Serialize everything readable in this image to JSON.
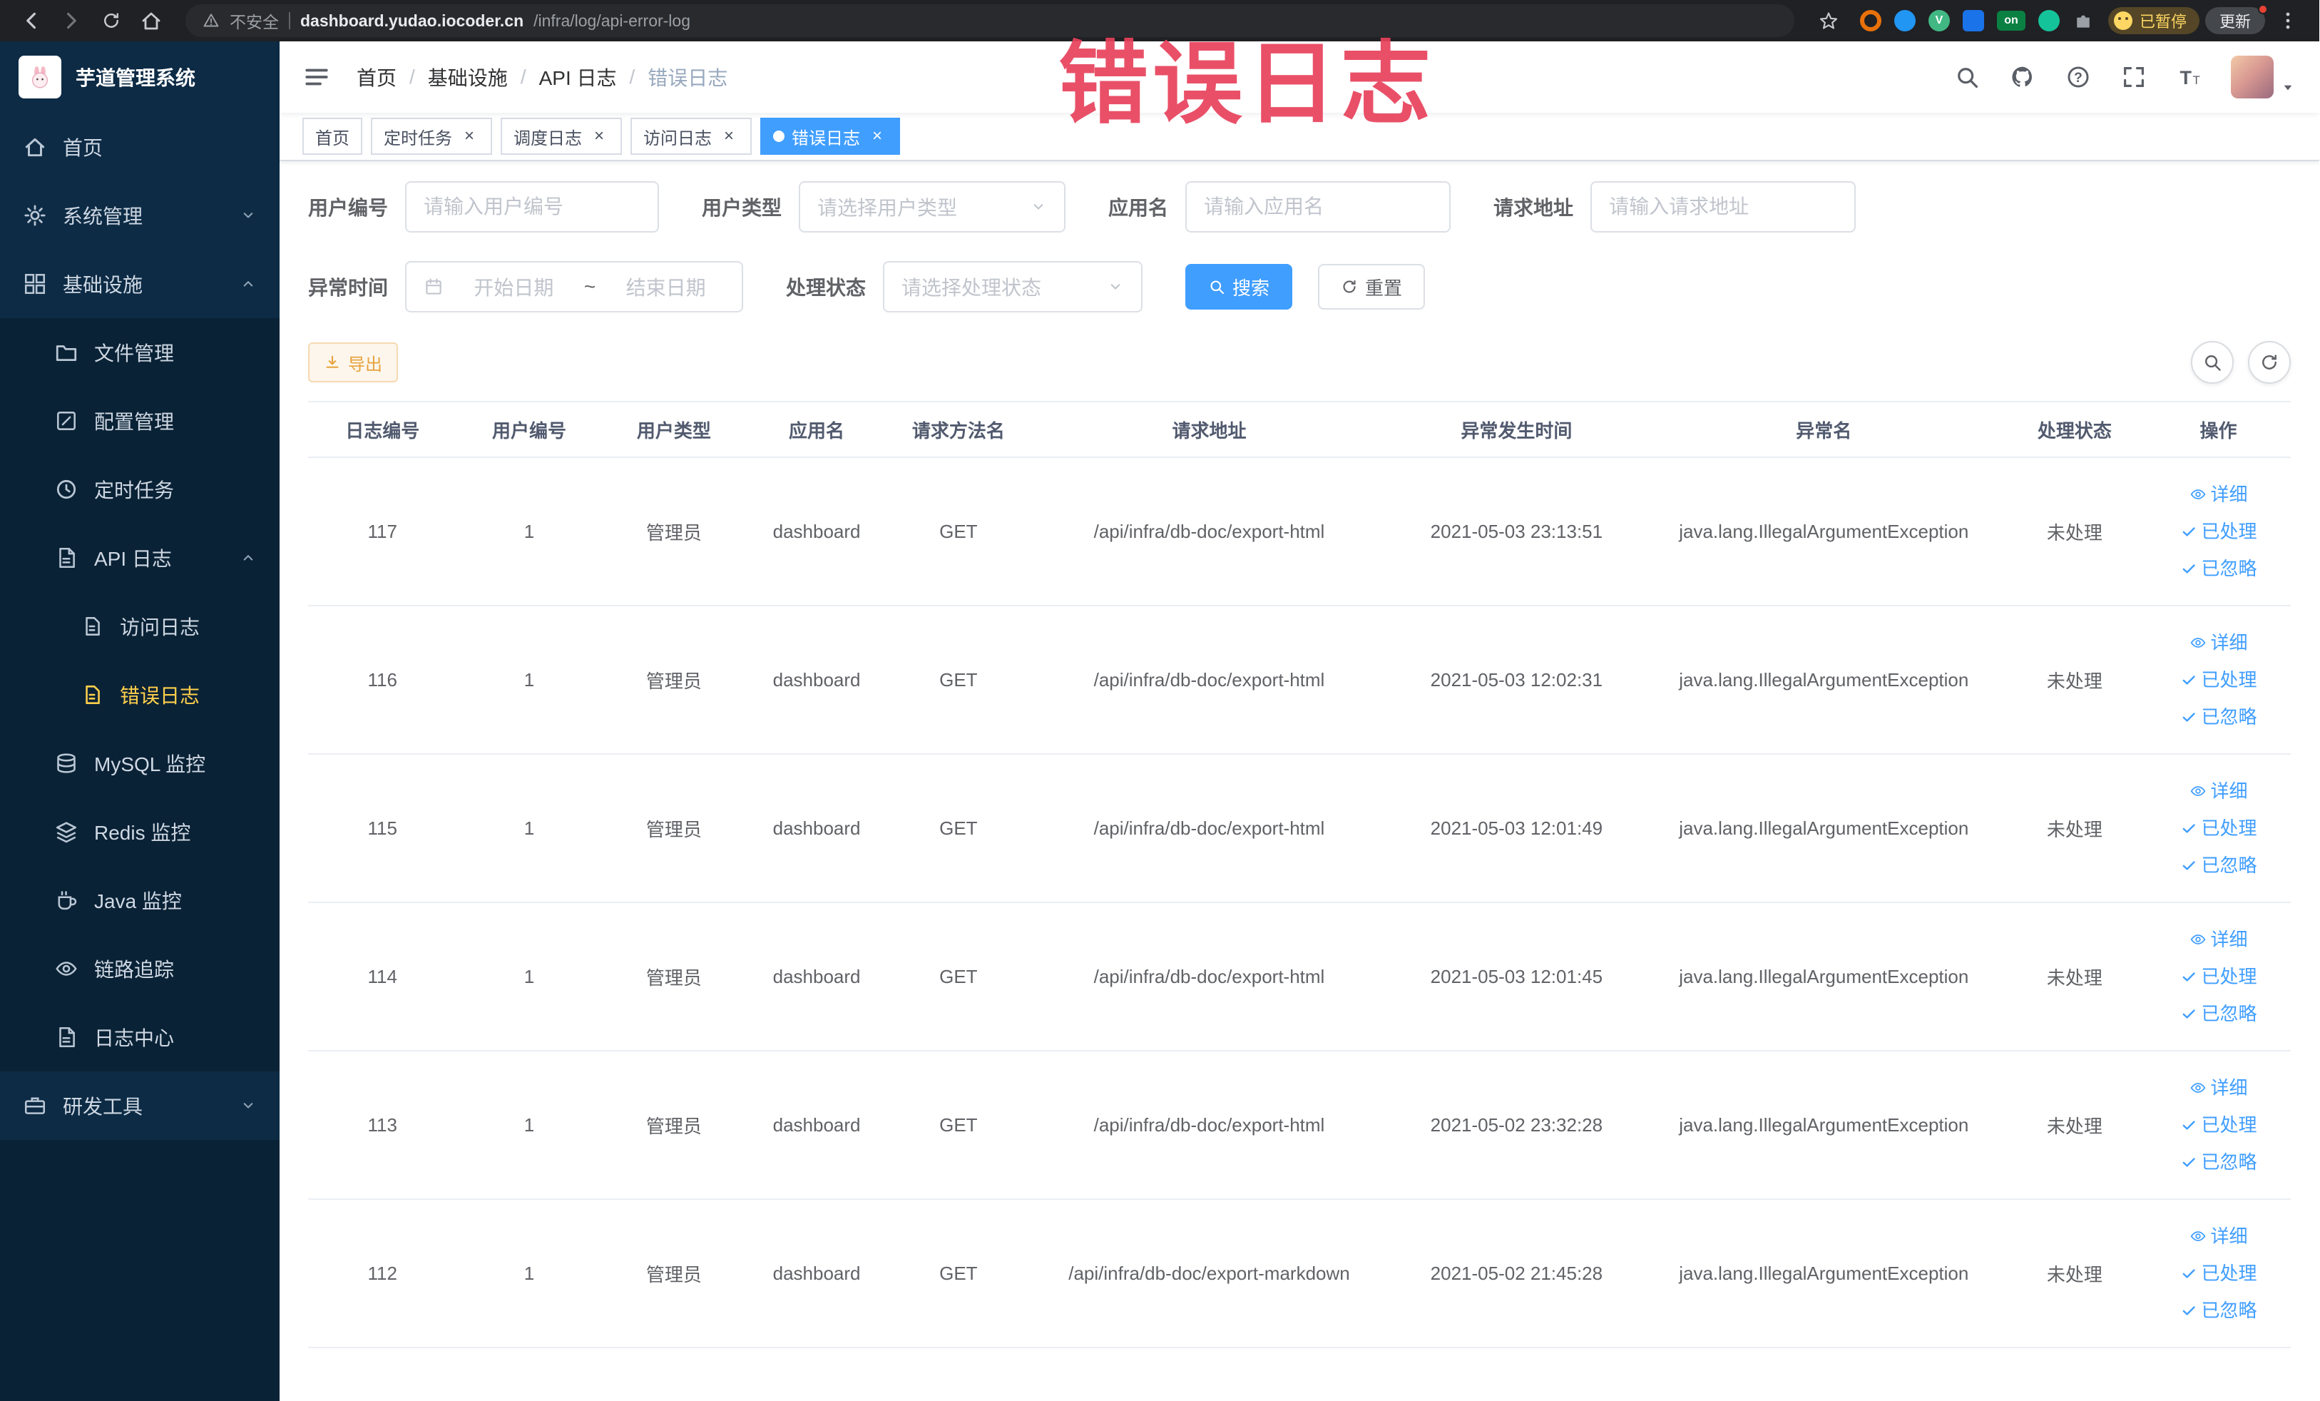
{
  "browser": {
    "security_label": "不安全",
    "url_host": "dashboard.yudao.iocoder.cn",
    "url_path": "/infra/log/api-error-log",
    "paused_label": "已暂停",
    "update_label": "更新",
    "ext_on_label": "on",
    "ext_v_label": "V"
  },
  "sidebar": {
    "logo_title": "芋道管理系统",
    "items": [
      {
        "label": "首页"
      },
      {
        "label": "系统管理"
      },
      {
        "label": "基础设施"
      },
      {
        "label": "文件管理"
      },
      {
        "label": "配置管理"
      },
      {
        "label": "定时任务"
      },
      {
        "label": "API 日志"
      },
      {
        "label": "访问日志"
      },
      {
        "label": "错误日志"
      },
      {
        "label": "MySQL 监控"
      },
      {
        "label": "Redis 监控"
      },
      {
        "label": "Java 监控"
      },
      {
        "label": "链路追踪"
      },
      {
        "label": "日志中心"
      },
      {
        "label": "研发工具"
      }
    ]
  },
  "navbar": {
    "breadcrumb": [
      "首页",
      "基础设施",
      "API 日志",
      "错误日志"
    ]
  },
  "tabs": [
    {
      "label": "首页"
    },
    {
      "label": "定时任务"
    },
    {
      "label": "调度日志"
    },
    {
      "label": "访问日志"
    },
    {
      "label": "错误日志"
    }
  ],
  "watermark": "错误日志",
  "filters": {
    "user_id_label": "用户编号",
    "user_id_placeholder": "请输入用户编号",
    "user_type_label": "用户类型",
    "user_type_placeholder": "请选择用户类型",
    "app_name_label": "应用名",
    "app_name_placeholder": "请输入应用名",
    "request_url_label": "请求地址",
    "request_url_placeholder": "请输入请求地址",
    "exception_time_label": "异常时间",
    "start_placeholder": "开始日期",
    "range_separator": "~",
    "end_placeholder": "结束日期",
    "process_status_label": "处理状态",
    "process_status_placeholder": "请选择处理状态",
    "search_label": "搜索",
    "reset_label": "重置"
  },
  "toolbar": {
    "export_label": "导出"
  },
  "table": {
    "headers": [
      "日志编号",
      "用户编号",
      "用户类型",
      "应用名",
      "请求方法名",
      "请求地址",
      "异常发生时间",
      "异常名",
      "处理状态",
      "操作"
    ],
    "actions": [
      "详细",
      "已处理",
      "已忽略"
    ],
    "rows": [
      {
        "id": "117",
        "user_id": "1",
        "user_type": "管理员",
        "app": "dashboard",
        "method": "GET",
        "url": "/api/infra/db-doc/export-html",
        "time": "2021-05-03 23:13:51",
        "exception": "java.lang.IllegalArgumentException",
        "status": "未处理"
      },
      {
        "id": "116",
        "user_id": "1",
        "user_type": "管理员",
        "app": "dashboard",
        "method": "GET",
        "url": "/api/infra/db-doc/export-html",
        "time": "2021-05-03 12:02:31",
        "exception": "java.lang.IllegalArgumentException",
        "status": "未处理"
      },
      {
        "id": "115",
        "user_id": "1",
        "user_type": "管理员",
        "app": "dashboard",
        "method": "GET",
        "url": "/api/infra/db-doc/export-html",
        "time": "2021-05-03 12:01:49",
        "exception": "java.lang.IllegalArgumentException",
        "status": "未处理"
      },
      {
        "id": "114",
        "user_id": "1",
        "user_type": "管理员",
        "app": "dashboard",
        "method": "GET",
        "url": "/api/infra/db-doc/export-html",
        "time": "2021-05-03 12:01:45",
        "exception": "java.lang.IllegalArgumentException",
        "status": "未处理"
      },
      {
        "id": "113",
        "user_id": "1",
        "user_type": "管理员",
        "app": "dashboard",
        "method": "GET",
        "url": "/api/infra/db-doc/export-html",
        "time": "2021-05-02 23:32:28",
        "exception": "java.lang.IllegalArgumentException",
        "status": "未处理"
      },
      {
        "id": "112",
        "user_id": "1",
        "user_type": "管理员",
        "app": "dashboard",
        "method": "GET",
        "url": "/api/infra/db-doc/export-markdown",
        "time": "2021-05-02 21:45:28",
        "exception": "java.lang.IllegalArgumentException",
        "status": "未处理"
      }
    ]
  },
  "colors": {
    "primary": "#409eff",
    "sidebar_active": "#ffd04b",
    "watermark": "#e8425c",
    "warning": "#e6a23c"
  }
}
